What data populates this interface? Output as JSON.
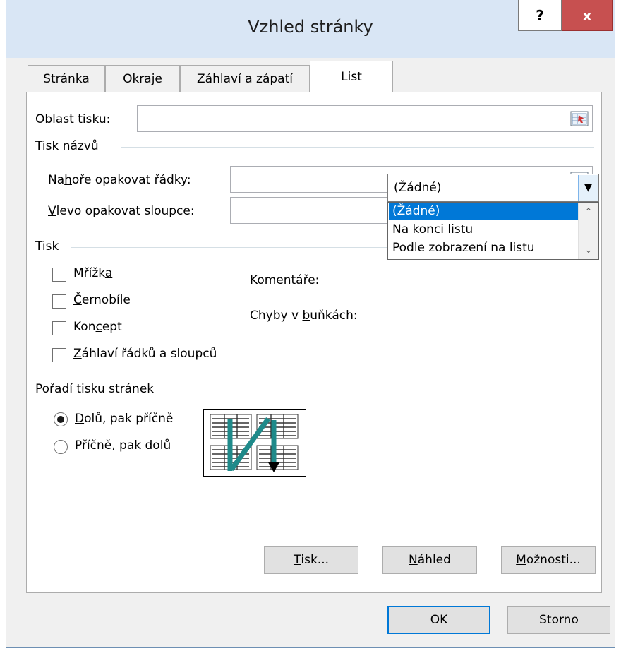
{
  "window": {
    "title": "Vzhled stránky",
    "help": "?",
    "close": "x"
  },
  "tabs": [
    {
      "label": "Stránka"
    },
    {
      "label": "Okraje"
    },
    {
      "label": "Záhlaví a zápatí"
    },
    {
      "label": "List"
    }
  ],
  "print_area": {
    "label_u": "O",
    "label_rest": "blast tisku:",
    "value": ""
  },
  "print_titles": {
    "group_label": "Tisk názvů",
    "rows": {
      "pre": "Na",
      "u": "h",
      "post": "oře opakovat řádky:",
      "value": ""
    },
    "cols": {
      "pre": "",
      "u": "V",
      "post": "levo opakovat sloupce:",
      "value": ""
    }
  },
  "print": {
    "group_label": "Tisk",
    "gridlines": {
      "pre": "Mřížk",
      "u": "a",
      "post": "",
      "checked": false
    },
    "bw": {
      "pre": "",
      "u": "Č",
      "post": "ernobíle",
      "checked": false
    },
    "draft": {
      "pre": "Kon",
      "u": "c",
      "post": "ept",
      "checked": false
    },
    "headings": {
      "pre": "",
      "u": "Z",
      "post": "áhlaví řádků a sloupců",
      "checked": false
    },
    "comments": {
      "pre": "",
      "u": "K",
      "post": "omentáře:",
      "value": "(Žádné)"
    },
    "errors": {
      "pre": "Chyby v ",
      "u": "b",
      "post": "uňkách:"
    },
    "dropdown_options": [
      "(Žádné)",
      "Na konci listu",
      "Podle zobrazení na listu"
    ],
    "dropdown_selected": 0
  },
  "page_order": {
    "group_label": "Pořadí tisku stránek",
    "down_then_over": {
      "pre": "",
      "u": "D",
      "post": "olů, pak příčně",
      "checked": true
    },
    "over_then_down": {
      "pre": "Příčně, pak dol",
      "u": "ů",
      "post": "",
      "checked": false
    }
  },
  "panel_buttons": {
    "print": {
      "pre": "",
      "u": "T",
      "post": "isk..."
    },
    "preview": {
      "pre": "",
      "u": "N",
      "post": "áhled"
    },
    "options": {
      "pre": "",
      "u": "M",
      "post": "ožnosti..."
    }
  },
  "dialog_buttons": {
    "ok": "OK",
    "cancel": "Storno"
  },
  "colors": {
    "accent": "#0078d7",
    "titlebar": "#d9e6f5",
    "close": "#c75050",
    "diagram_arrow": "#1f8a8a"
  },
  "icons": {
    "collapse": "collapse-dialog-icon",
    "dropdown": "chevron-down-icon",
    "diagram": "page-order-diagram-icon"
  }
}
